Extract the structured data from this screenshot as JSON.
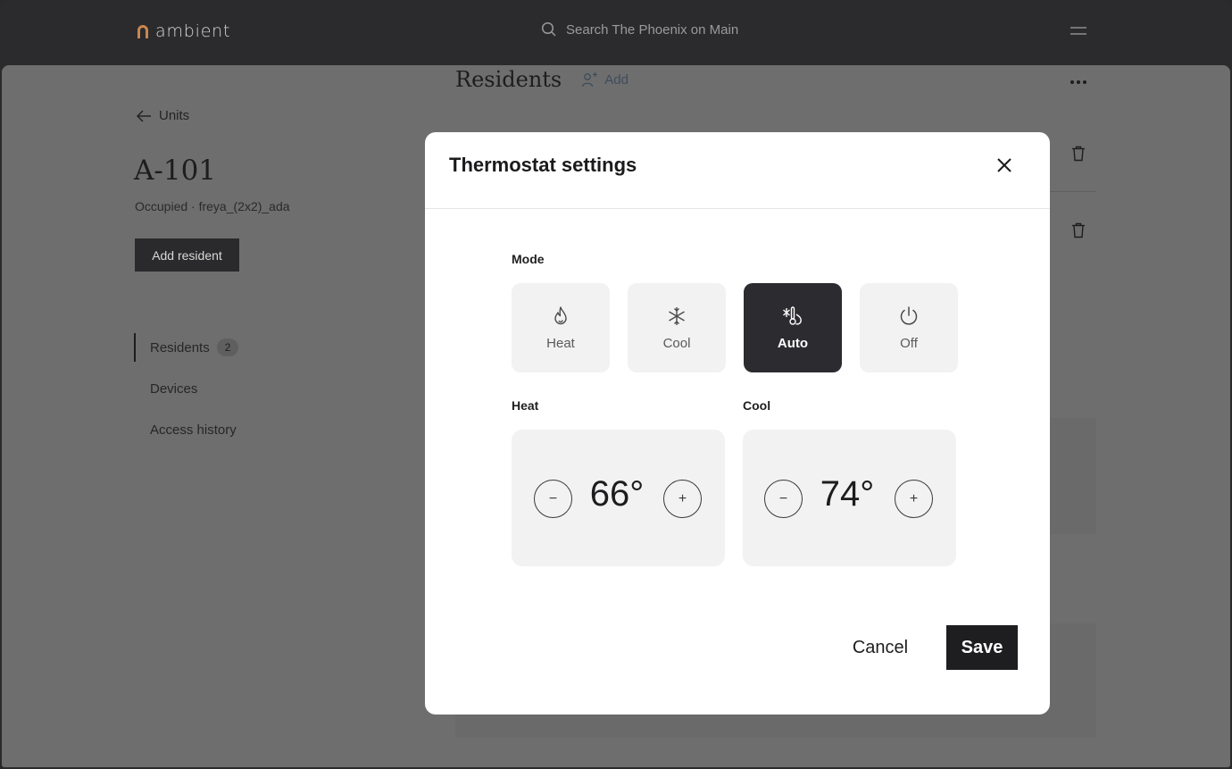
{
  "app": {
    "logo_text": "ambient",
    "search_placeholder": "Search The Phoenix on Main"
  },
  "unit": {
    "back_label": "Units",
    "title": "A-101",
    "subtitle": "Occupied · freya_(2x2)_ada",
    "add_resident_label": "Add resident"
  },
  "sidebar": {
    "items": [
      {
        "label": "Residents",
        "count": "2",
        "active": true
      },
      {
        "label": "Devices"
      },
      {
        "label": "Access history"
      }
    ]
  },
  "residents": {
    "title": "Residents",
    "add_label": "Add"
  },
  "modal": {
    "title": "Thermostat settings",
    "mode_label": "Mode",
    "modes": [
      {
        "label": "Heat",
        "icon": "flame-icon"
      },
      {
        "label": "Cool",
        "icon": "snowflake-icon"
      },
      {
        "label": "Auto",
        "icon": "auto-thermo-icon",
        "selected": true
      },
      {
        "label": "Off",
        "icon": "power-icon"
      }
    ],
    "heat": {
      "label": "Heat",
      "value": "66°",
      "minus": "−",
      "plus": "+"
    },
    "cool": {
      "label": "Cool",
      "value": "74°",
      "minus": "−",
      "plus": "+"
    },
    "cancel_label": "Cancel",
    "save_label": "Save"
  },
  "colors": {
    "topbar": "#2b2b2d",
    "overlay": "#6e6e6e",
    "modal_bg": "#ffffff",
    "card_bg": "#f2f2f2",
    "selected_mode": "#2c2b2f",
    "primary_button": "#1e1e20",
    "logo_accent": "#c8874e"
  }
}
